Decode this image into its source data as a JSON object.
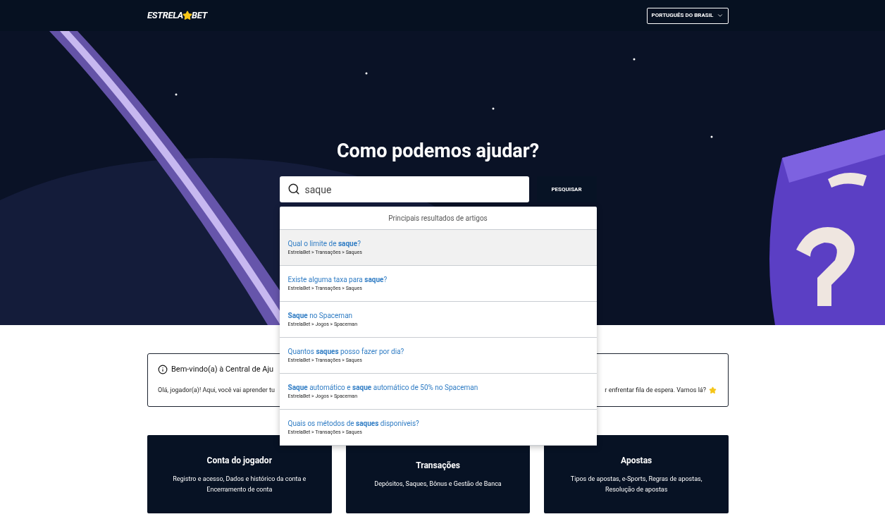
{
  "header": {
    "logo": {
      "left": "ESTRELA",
      "right": "BET"
    },
    "language": "PORTUGUÊS DO BRASIL"
  },
  "hero": {
    "kind": "picture",
    "title": "Como podemos ajudar?",
    "search": {
      "value": "saque",
      "button": "PESQUISAR"
    }
  },
  "results": {
    "heading": "Principais resultados de artigos",
    "items": [
      {
        "title": "Qual o limite de **saque**?",
        "path": "EstrelaBet > Transações > Saques",
        "selected": true
      },
      {
        "title": "Existe alguma taxa para **saque**?",
        "path": "EstrelaBet > Transações > Saques",
        "selected": false
      },
      {
        "title": "**Saque** no Spaceman",
        "path": "EstrelaBet > Jogos > Spaceman",
        "selected": false
      },
      {
        "title": "Quantos **saques** posso fazer por dia?",
        "path": "EstrelaBet > Transações > Saques",
        "selected": false
      },
      {
        "title": "**Saque** automático e **saque** automático de 50% no Spaceman",
        "path": "EstrelaBet > Jogos > Spaceman",
        "selected": false
      },
      {
        "title": "Quais os métodos de **saques** disponíveis?",
        "path": "EstrelaBet > Transações > Saques",
        "selected": false
      }
    ]
  },
  "welcome": {
    "title": "Bem-vindo(a) à Central de Aju",
    "text_left": "Olá, jogador(a)! Aqui, você vai aprender tu",
    "text_right": "r enfrentar fila de espera. Vamos lá?"
  },
  "categories": [
    {
      "title": "Conta do jogador",
      "description": "Registro e acesso, Dados e histórico da conta e Encerramento de conta"
    },
    {
      "title": "Transações",
      "description": "Depósitos, Saques, Bônus e Gestão de Banca"
    },
    {
      "title": "Apostas",
      "description": "Tipos de apostas, e-Sports, Regras de apostas, Resolução de apostas"
    }
  ]
}
